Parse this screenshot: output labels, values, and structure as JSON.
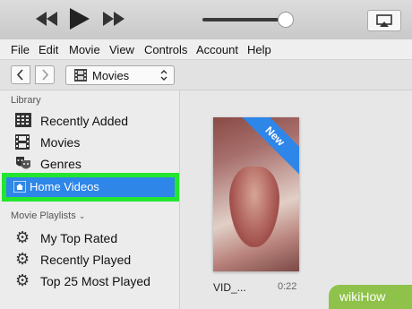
{
  "player": {
    "volume_level": 0.96
  },
  "menu": [
    "File",
    "Edit",
    "Movie",
    "View",
    "Controls",
    "Account",
    "Help"
  ],
  "navbar": {
    "media_selector": "Movies"
  },
  "sidebar": {
    "library_header": "Library",
    "library_items": [
      {
        "label": "Recently Added",
        "icon": "grid-icon"
      },
      {
        "label": "Movies",
        "icon": "film-icon"
      },
      {
        "label": "Genres",
        "icon": "masks-icon"
      },
      {
        "label": "Home Videos",
        "icon": "home-video-icon",
        "selected": true
      }
    ],
    "playlists_header": "Movie Playlists",
    "playlist_items": [
      {
        "label": "My Top Rated",
        "icon": "gear-icon"
      },
      {
        "label": "Recently Played",
        "icon": "gear-icon"
      },
      {
        "label": "Top 25 Most Played",
        "icon": "gear-icon"
      }
    ]
  },
  "main": {
    "video": {
      "title": "VID_...",
      "duration": "0:22",
      "badge": "New"
    }
  },
  "watermark": {
    "brand": "wikiHow"
  },
  "colors": {
    "accent": "#2e86e8",
    "highlight": "#22e52f",
    "watermark": "#8fc24a"
  }
}
